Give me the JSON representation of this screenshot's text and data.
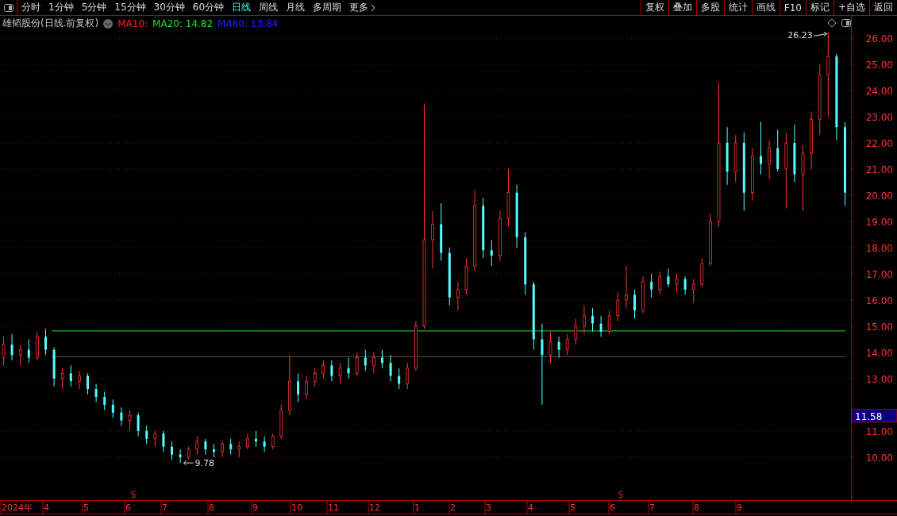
{
  "toolbar": {
    "periods": [
      {
        "label": "分时",
        "selected": false
      },
      {
        "label": "1分钟",
        "selected": false
      },
      {
        "label": "5分钟",
        "selected": false
      },
      {
        "label": "15分钟",
        "selected": false
      },
      {
        "label": "30分钟",
        "selected": false
      },
      {
        "label": "60分钟",
        "selected": false
      },
      {
        "label": "日线",
        "selected": true
      },
      {
        "label": "周线",
        "selected": false
      },
      {
        "label": "月线",
        "selected": false
      },
      {
        "label": "多周期",
        "selected": false
      },
      {
        "label": "更多",
        "selected": false
      }
    ],
    "actions": [
      "复权",
      "叠加",
      "多股",
      "统计",
      "画线",
      "F10",
      "标记",
      "+自选",
      "返回"
    ]
  },
  "legend": {
    "title": "雄韬股份(日线.前复权)",
    "indicators": [
      {
        "label": "MA10:",
        "color": "#ff2020"
      },
      {
        "label": "MA20: 14.82",
        "color": "#20e020"
      },
      {
        "label": "MA60: 13.84",
        "color": "#2020ff"
      }
    ]
  },
  "chart": {
    "high_label": "26.23",
    "low_label": "9.78",
    "signals": [
      "S",
      "S"
    ],
    "last_price": "11.58",
    "months": [
      "2024年",
      "4",
      "5",
      "6",
      "7",
      "8",
      "9",
      "10",
      "11",
      "12",
      "1",
      "2",
      "3",
      "4",
      "5",
      "6",
      "7",
      "8",
      "9"
    ],
    "chart_data": {
      "type": "candlestick",
      "ylim": [
        8.36,
        26.85
      ],
      "grid": true,
      "ref_lines": [
        {
          "axis": "y",
          "value": 14.82,
          "color": "#20e020"
        },
        {
          "axis": "y",
          "value": 13.84,
          "color": "#555555"
        }
      ],
      "yticks": [
        {
          "value": 26,
          "label": "26.00"
        },
        {
          "value": 25,
          "label": "25.00"
        },
        {
          "value": 24,
          "label": "24.00"
        },
        {
          "value": 23,
          "label": "23.00"
        },
        {
          "value": 22,
          "label": "22.00"
        },
        {
          "value": 21,
          "label": "21.00"
        },
        {
          "value": 20,
          "label": "20.00"
        },
        {
          "value": 19,
          "label": "19.00"
        },
        {
          "value": 18,
          "label": "18.00"
        },
        {
          "value": 17,
          "label": "17.00"
        },
        {
          "value": 16,
          "label": "16.00"
        },
        {
          "value": 15,
          "label": "15.00"
        },
        {
          "value": 14,
          "label": "14.00"
        },
        {
          "value": 13,
          "label": "13.00"
        },
        {
          "value": 11,
          "label": "11.00"
        },
        {
          "value": 10,
          "label": "10.00"
        }
      ],
      "ohlc": [
        [
          13.8,
          14.6,
          13.5,
          14.3
        ],
        [
          14.3,
          14.7,
          13.7,
          13.9
        ],
        [
          13.9,
          14.3,
          13.5,
          14.1
        ],
        [
          14.1,
          14.5,
          13.6,
          13.8
        ],
        [
          13.8,
          14.8,
          13.7,
          14.6
        ],
        [
          14.6,
          14.9,
          13.9,
          14.1
        ],
        [
          14.1,
          14.2,
          12.7,
          13.0
        ],
        [
          13.0,
          13.4,
          12.6,
          13.2
        ],
        [
          13.2,
          13.5,
          12.7,
          12.9
        ],
        [
          12.9,
          13.3,
          12.6,
          13.1
        ],
        [
          13.1,
          13.2,
          12.4,
          12.6
        ],
        [
          12.6,
          12.8,
          12.1,
          12.3
        ],
        [
          12.3,
          12.5,
          11.8,
          12.0
        ],
        [
          12.0,
          12.2,
          11.5,
          11.7
        ],
        [
          11.7,
          11.9,
          11.2,
          11.4
        ],
        [
          11.4,
          11.8,
          11.0,
          11.6
        ],
        [
          11.6,
          11.7,
          10.8,
          11.0
        ],
        [
          11.0,
          11.2,
          10.5,
          10.7
        ],
        [
          10.7,
          11.0,
          10.4,
          10.9
        ],
        [
          10.9,
          11.0,
          10.2,
          10.4
        ],
        [
          10.4,
          10.6,
          9.9,
          10.1
        ],
        [
          10.1,
          10.3,
          9.78,
          10.0
        ],
        [
          10.0,
          10.4,
          9.9,
          10.3
        ],
        [
          10.3,
          10.8,
          10.1,
          10.6
        ],
        [
          10.6,
          10.7,
          10.1,
          10.3
        ],
        [
          10.3,
          10.5,
          10.0,
          10.2
        ],
        [
          10.2,
          10.6,
          10.0,
          10.5
        ],
        [
          10.5,
          10.7,
          10.1,
          10.3
        ],
        [
          10.3,
          10.6,
          10.0,
          10.4
        ],
        [
          10.4,
          10.9,
          10.3,
          10.7
        ],
        [
          10.7,
          11.0,
          10.4,
          10.6
        ],
        [
          10.6,
          10.8,
          10.2,
          10.4
        ],
        [
          10.4,
          10.9,
          10.3,
          10.8
        ],
        [
          10.8,
          12.0,
          10.7,
          11.8
        ],
        [
          11.8,
          13.9,
          11.6,
          12.9
        ],
        [
          12.9,
          13.2,
          12.1,
          12.4
        ],
        [
          12.4,
          13.1,
          12.2,
          12.9
        ],
        [
          12.9,
          13.4,
          12.7,
          13.2
        ],
        [
          13.2,
          13.7,
          13.0,
          13.5
        ],
        [
          13.5,
          13.7,
          12.9,
          13.1
        ],
        [
          13.1,
          13.6,
          12.8,
          13.4
        ],
        [
          13.4,
          13.8,
          13.0,
          13.2
        ],
        [
          13.2,
          14.0,
          13.1,
          13.8
        ],
        [
          13.8,
          14.1,
          13.3,
          13.5
        ],
        [
          13.5,
          14.0,
          13.2,
          13.8
        ],
        [
          13.8,
          14.1,
          13.4,
          13.6
        ],
        [
          13.6,
          13.9,
          12.9,
          13.1
        ],
        [
          13.1,
          13.4,
          12.6,
          12.8
        ],
        [
          12.8,
          13.6,
          12.6,
          13.4
        ],
        [
          13.4,
          15.2,
          13.3,
          15.0
        ],
        [
          15.0,
          23.5,
          14.9,
          18.3
        ],
        [
          18.3,
          19.4,
          17.2,
          18.9
        ],
        [
          18.9,
          19.7,
          17.5,
          17.8
        ],
        [
          17.8,
          18.0,
          15.8,
          16.1
        ],
        [
          16.1,
          16.7,
          15.6,
          16.4
        ],
        [
          16.4,
          17.6,
          16.2,
          17.3
        ],
        [
          17.3,
          20.2,
          17.1,
          19.6
        ],
        [
          19.6,
          19.9,
          17.6,
          17.9
        ],
        [
          17.9,
          18.3,
          17.3,
          17.7
        ],
        [
          17.7,
          19.4,
          17.5,
          19.1
        ],
        [
          19.1,
          21.0,
          18.8,
          20.1
        ],
        [
          20.1,
          20.4,
          18.0,
          18.4
        ],
        [
          18.4,
          18.6,
          16.2,
          16.6
        ],
        [
          16.6,
          16.7,
          14.1,
          14.5
        ],
        [
          14.5,
          15.1,
          12.0,
          13.9
        ],
        [
          13.9,
          14.8,
          13.6,
          14.4
        ],
        [
          14.4,
          14.6,
          13.8,
          14.1
        ],
        [
          14.1,
          14.7,
          13.9,
          14.5
        ],
        [
          14.5,
          15.3,
          14.3,
          15.0
        ],
        [
          15.0,
          15.8,
          14.7,
          15.4
        ],
        [
          15.4,
          15.7,
          14.8,
          15.1
        ],
        [
          15.1,
          15.4,
          14.6,
          14.8
        ],
        [
          14.8,
          15.6,
          14.7,
          15.4
        ],
        [
          15.4,
          16.3,
          15.2,
          16.0
        ],
        [
          16.0,
          17.3,
          15.7,
          16.2
        ],
        [
          16.2,
          16.4,
          15.3,
          15.6
        ],
        [
          15.6,
          16.9,
          15.5,
          16.7
        ],
        [
          16.7,
          17.0,
          16.1,
          16.4
        ],
        [
          16.4,
          17.1,
          16.2,
          16.9
        ],
        [
          16.9,
          17.2,
          16.5,
          16.6
        ],
        [
          16.6,
          17.0,
          16.3,
          16.8
        ],
        [
          16.8,
          16.9,
          16.2,
          16.4
        ],
        [
          16.4,
          16.8,
          15.9,
          16.6
        ],
        [
          16.6,
          17.6,
          16.5,
          17.4
        ],
        [
          17.4,
          19.3,
          17.3,
          19.0
        ],
        [
          19.0,
          24.3,
          18.8,
          22.0
        ],
        [
          22.0,
          22.6,
          20.4,
          20.9
        ],
        [
          20.9,
          22.3,
          20.5,
          22.0
        ],
        [
          22.0,
          22.4,
          19.4,
          20.1
        ],
        [
          20.1,
          21.8,
          19.8,
          21.5
        ],
        [
          21.5,
          22.8,
          20.8,
          21.2
        ],
        [
          21.2,
          22.1,
          20.6,
          21.8
        ],
        [
          21.8,
          22.5,
          20.9,
          21.0
        ],
        [
          21.0,
          22.4,
          19.5,
          22.0
        ],
        [
          22.0,
          22.7,
          20.5,
          20.8
        ],
        [
          20.8,
          21.9,
          19.4,
          21.6
        ],
        [
          21.6,
          23.2,
          21.0,
          22.9
        ],
        [
          22.9,
          25.0,
          22.3,
          24.6
        ],
        [
          24.6,
          26.23,
          23.0,
          25.3
        ],
        [
          25.3,
          25.4,
          22.1,
          22.6
        ],
        [
          22.6,
          22.8,
          19.6,
          20.1
        ]
      ]
    }
  }
}
